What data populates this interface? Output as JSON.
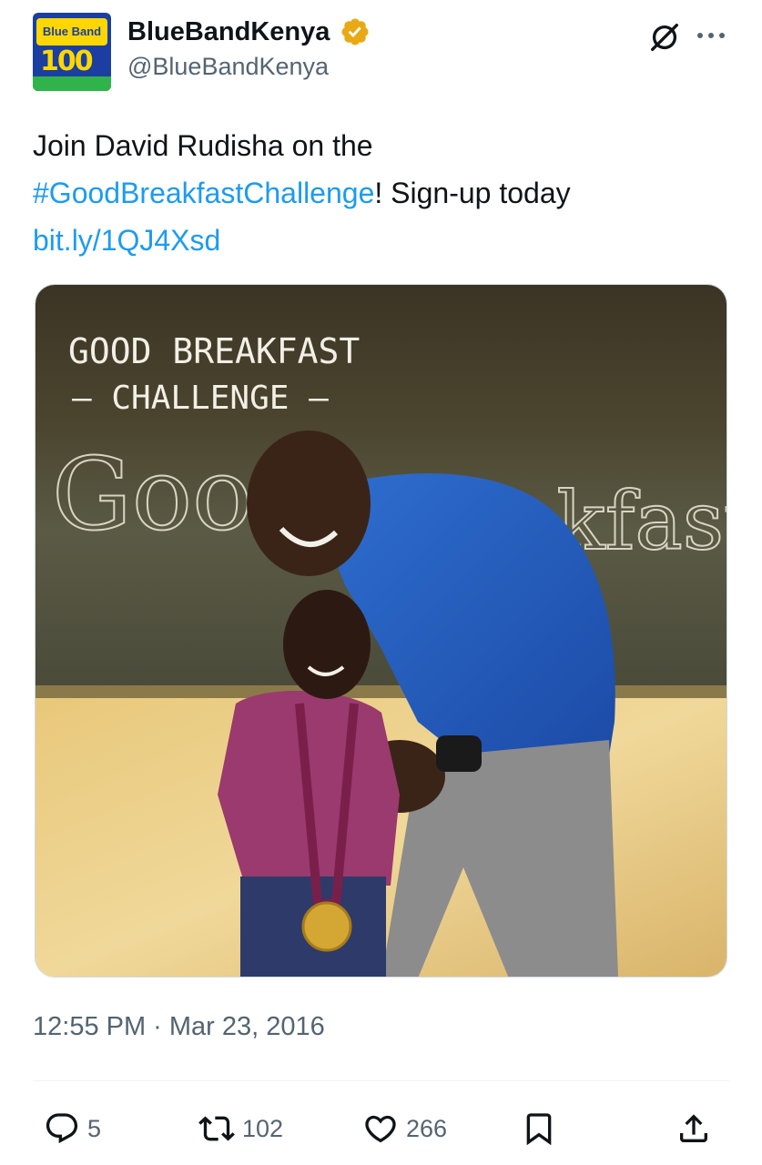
{
  "author": {
    "display_name": "BlueBandKenya",
    "handle": "@BlueBandKenya",
    "avatar_text_top": "Blue Band",
    "avatar_text_num": "100"
  },
  "tweet": {
    "text_line1": "Join David Rudisha on the",
    "hashtag": "#GoodBreakfastChallenge",
    "text_after_hashtag": "! Sign-up today",
    "link": "bit.ly/1QJ4Xsd"
  },
  "media": {
    "overlay_line1": "GOOD BREAKFAST",
    "overlay_line2": "– CHALLENGE –",
    "chalk_left": "Good",
    "chalk_right": "akfast"
  },
  "timestamp": "12:55 PM · Mar 23, 2016",
  "stats": {
    "replies": "5",
    "retweets": "102",
    "likes": "266"
  },
  "colors": {
    "link": "#1d9bf0",
    "muted": "#536471",
    "verified_badge": "#e8a915"
  }
}
